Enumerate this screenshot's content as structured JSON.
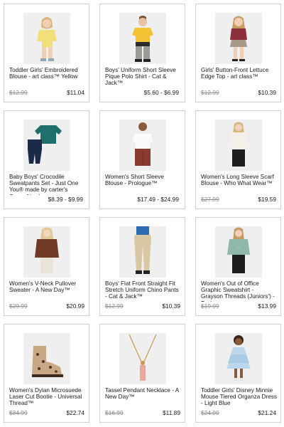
{
  "products": [
    {
      "id": "toddler-blouse",
      "title": "Toddler Girls' Embroidered Blouse - art class™ Yellow",
      "was_price": "$12.99",
      "price": "$11.04"
    },
    {
      "id": "boys-polo",
      "title": "Boys' Uniform Short Sleeve Pique Polo Shirt - Cat & Jack™",
      "was_price": "",
      "price": "$5.60 - $6.99"
    },
    {
      "id": "girls-lettuce-top",
      "title": "Girls' Button-Front Lettuce Edge Top - art class™",
      "was_price": "$12.99",
      "price": "$10.39"
    },
    {
      "id": "baby-sweatpants-set",
      "title": "Baby Boys' Crocodile Sweatpants Set - Just One You® made by carter's Green Newb...",
      "was_price": "",
      "price": "$8.39 - $9.99"
    },
    {
      "id": "womens-short-sleeve-blouse",
      "title": "Women's Short Sleeve Blouse - Prologue™",
      "was_price": "",
      "price": "$17.49 - $24.99"
    },
    {
      "id": "womens-scarf-blouse",
      "title": "Women's Long Sleeve Scarf Blouse - Who What Wear™",
      "was_price": "$27.99",
      "price": "$19.59"
    },
    {
      "id": "womens-vneck-sweater",
      "title": "Women's V-Neck Pullover Sweater - A New Day™",
      "was_price": "$29.99",
      "price": "$20.99"
    },
    {
      "id": "boys-chino-pants",
      "title": "Boys' Flat Front Straight Fit Stretch Uniform Chino Pants - Cat & Jack™",
      "was_price": "$12.99",
      "price": "$10.39"
    },
    {
      "id": "womens-graphic-sweatshirt",
      "title": "Women's Out of Office Graphic Sweatshirt - Grayson Threads (Juniors') - Teal",
      "was_price": "$19.99",
      "price": "$13.99"
    },
    {
      "id": "womens-dylan-bootie",
      "title": "Women's Dylan Microsuede Laser Cut Bootie - Universal Thread™",
      "was_price": "$34.99",
      "price": "$22.74"
    },
    {
      "id": "tassel-necklace",
      "title": "Tassel Pendant Necklace - A New Day™",
      "was_price": "$16.99",
      "price": "$11.89"
    },
    {
      "id": "toddler-minnie-dress",
      "title": "Toddler Girls' Disney Minnie Mouse Tiered Organza Dress - Light Blue",
      "was_price": "$24.99",
      "price": "$21.24"
    }
  ]
}
